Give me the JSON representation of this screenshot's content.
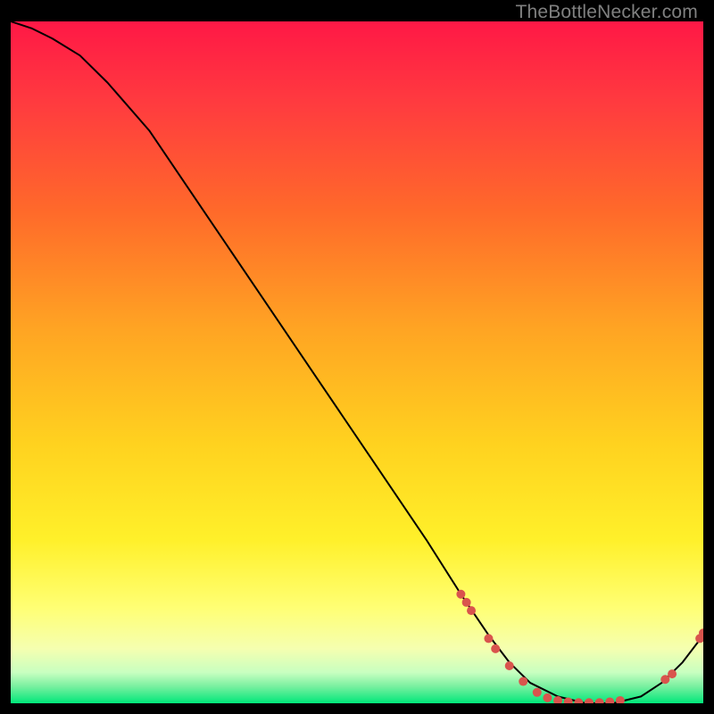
{
  "attribution": "TheBottleNecker.com",
  "chart_data": {
    "type": "line",
    "title": "",
    "xlabel": "",
    "ylabel": "",
    "xlim": [
      0,
      100
    ],
    "ylim": [
      0,
      100
    ],
    "grid": false,
    "background_gradient": [
      "#ff1744",
      "#ff5722",
      "#ffb300",
      "#ffeb3b",
      "#ffff8d",
      "#b9f6ca",
      "#00e676"
    ],
    "series": [
      {
        "name": "bottleneck-curve",
        "color": "#000000",
        "x": [
          0,
          3,
          6,
          10,
          14,
          20,
          28,
          36,
          44,
          52,
          60,
          65,
          69,
          72,
          75,
          79,
          83,
          87,
          91,
          94,
          97,
          100
        ],
        "y": [
          100,
          99,
          97.5,
          95,
          91,
          84,
          72,
          60,
          48,
          36,
          24,
          16,
          10,
          6,
          3,
          1,
          0,
          0,
          1,
          3,
          6,
          10
        ]
      }
    ],
    "markers": {
      "color": "#d9544d",
      "points": [
        {
          "x": 65.0,
          "y": 16.0
        },
        {
          "x": 65.8,
          "y": 14.8
        },
        {
          "x": 66.5,
          "y": 13.6
        },
        {
          "x": 69.0,
          "y": 9.5
        },
        {
          "x": 70.0,
          "y": 8.0
        },
        {
          "x": 72.0,
          "y": 5.5
        },
        {
          "x": 74.0,
          "y": 3.2
        },
        {
          "x": 76.0,
          "y": 1.6
        },
        {
          "x": 77.5,
          "y": 0.8
        },
        {
          "x": 79.0,
          "y": 0.4
        },
        {
          "x": 80.5,
          "y": 0.2
        },
        {
          "x": 82.0,
          "y": 0.1
        },
        {
          "x": 83.5,
          "y": 0.1
        },
        {
          "x": 85.0,
          "y": 0.1
        },
        {
          "x": 86.5,
          "y": 0.2
        },
        {
          "x": 88.0,
          "y": 0.4
        },
        {
          "x": 94.5,
          "y": 3.5
        },
        {
          "x": 95.5,
          "y": 4.3
        },
        {
          "x": 99.5,
          "y": 9.5
        },
        {
          "x": 100.0,
          "y": 10.3
        }
      ]
    }
  }
}
